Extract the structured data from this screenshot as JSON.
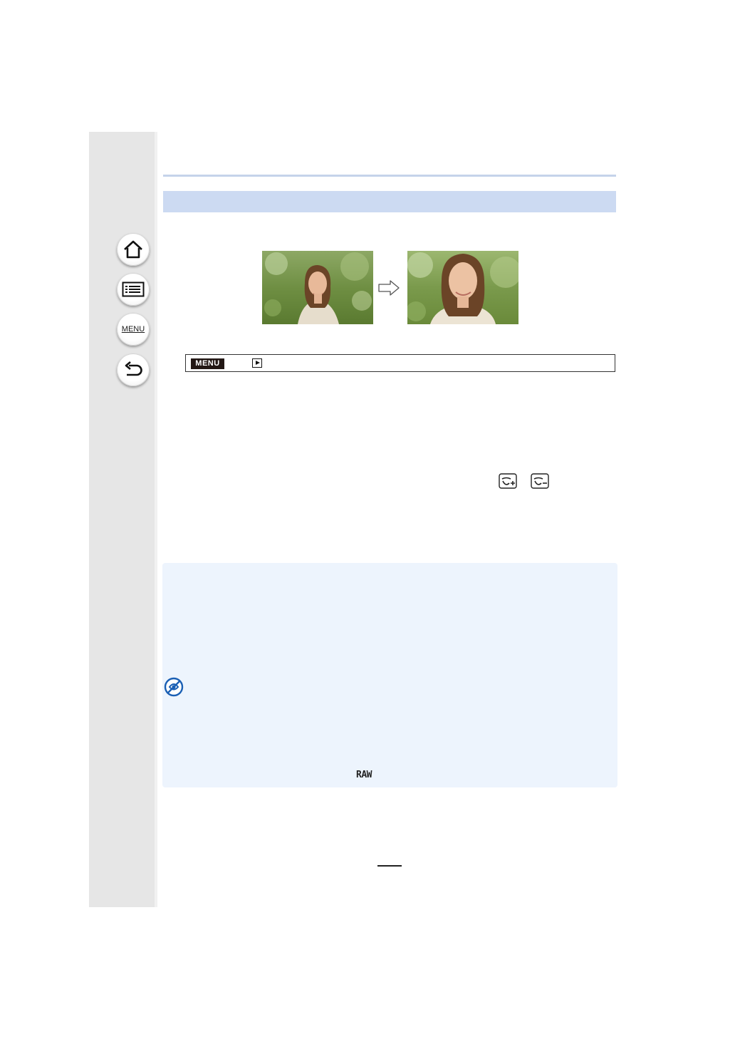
{
  "sidebar": {
    "home_icon": "house-icon",
    "contents_icon": "list-icon",
    "menu_label": "MENU",
    "back_icon": "return-arrow-icon"
  },
  "menu_path": {
    "badge": "MENU",
    "playback_icon": "playback-icon"
  },
  "photos": {
    "before": "woman-portrait-before",
    "after": "woman-portrait-after",
    "arrow_icon": "right-arrow-icon"
  },
  "face_icons": [
    "face-retouch-plus-icon",
    "face-retouch-minus-icon"
  ],
  "note": {
    "not_available_icon": "not-available-icon",
    "raw_label": "RAW"
  },
  "colors": {
    "sidebar": "#e6e6e6",
    "section_band": "#ccdaf2",
    "note_box": "#edf4fd",
    "not_available_icon": "#1a5fb4"
  }
}
